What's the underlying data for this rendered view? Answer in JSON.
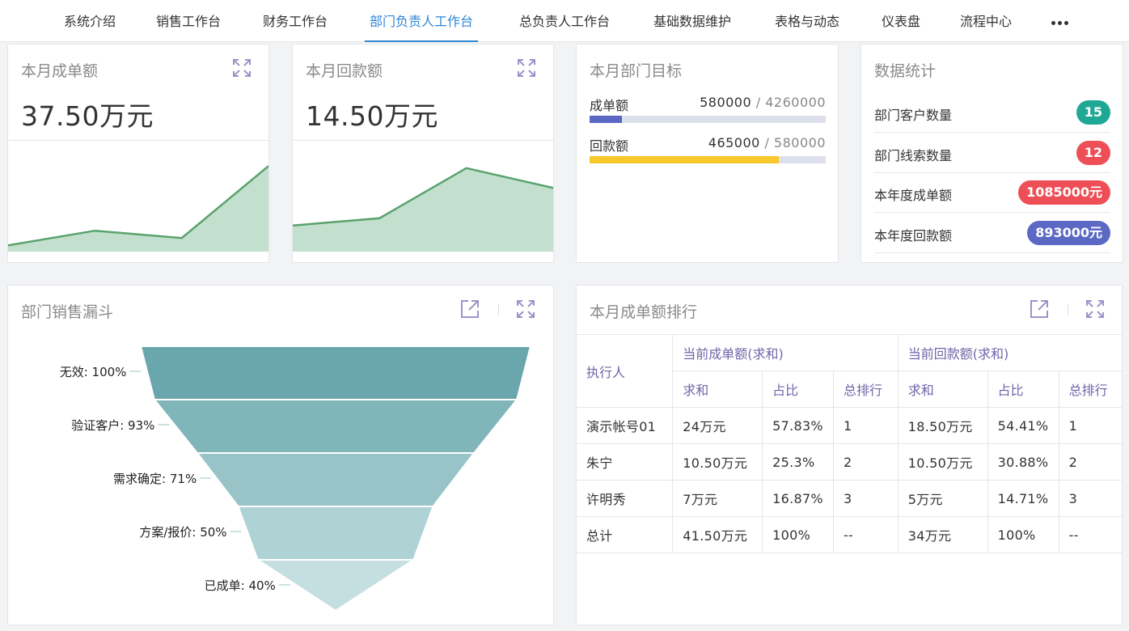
{
  "nav": {
    "items": [
      "系统介绍",
      "销售工作台",
      "财务工作台",
      "部门负责人工作台",
      "总负责人工作台",
      "基础数据维护",
      "表格与动态",
      "仪表盘",
      "流程中心"
    ],
    "active_index": 3,
    "more_icon": "ellipsis-icon"
  },
  "monthly_deal": {
    "title": "本月成单额",
    "value": "37.50万元",
    "trend": [
      0.06,
      0.2,
      0.13,
      0.82
    ]
  },
  "monthly_payment": {
    "title": "本月回款额",
    "value": "14.50万元",
    "trend": [
      0.25,
      0.32,
      0.8,
      0.61
    ]
  },
  "dept_target": {
    "title": "本月部门目标",
    "rows": [
      {
        "label": "成单额",
        "actual": "580000",
        "separator": "/",
        "target": "4260000",
        "progress": 0.136,
        "color": "#5b68c4"
      },
      {
        "label": "回款额",
        "actual": "465000",
        "separator": "/",
        "target": "580000",
        "progress": 0.8017,
        "color": "#f7c82c"
      }
    ]
  },
  "stats": {
    "title": "数据统计",
    "rows": [
      {
        "label": "部门客户数量",
        "value": "15",
        "color": "#1fa896"
      },
      {
        "label": "部门线索数量",
        "value": "12",
        "color": "#ee4e55"
      },
      {
        "label": "本年度成单额",
        "value": "1085000元",
        "color": "#ee4e55"
      },
      {
        "label": "本年度回款额",
        "value": "893000元",
        "color": "#5b68c4"
      }
    ]
  },
  "funnel": {
    "title": "部门销售漏斗",
    "stages": [
      {
        "label": "无效: 100%",
        "value": 100
      },
      {
        "label": "验证客户: 93%",
        "value": 93
      },
      {
        "label": "需求确定: 71%",
        "value": 71
      },
      {
        "label": "方案/报价: 50%",
        "value": 50
      },
      {
        "label": "已成单: 40%",
        "value": 40
      }
    ],
    "colors": [
      "#6aa7ad",
      "#80b5ba",
      "#98c4c8",
      "#afd2d5",
      "#c5dfe1"
    ]
  },
  "ranking": {
    "title": "本月成单额排行",
    "group_headers": [
      "执行人",
      "当前成单额(求和)",
      "当前回款额(求和)"
    ],
    "sub_headers": [
      "求和",
      "占比",
      "总排行",
      "求和",
      "占比",
      "总排行"
    ],
    "rows": [
      [
        "演示帐号01",
        "24万元",
        "57.83%",
        "1",
        "18.50万元",
        "54.41%",
        "1"
      ],
      [
        "朱宁",
        "10.50万元",
        "25.3%",
        "2",
        "10.50万元",
        "30.88%",
        "2"
      ],
      [
        "许明秀",
        "7万元",
        "16.87%",
        "3",
        "5万元",
        "14.71%",
        "3"
      ],
      [
        "总计",
        "41.50万元",
        "100%",
        "--",
        "34万元",
        "100%",
        "--"
      ]
    ]
  },
  "icons": {
    "expand": "expand-icon",
    "open": "open-external-icon",
    "accent": "#9a95c9"
  }
}
